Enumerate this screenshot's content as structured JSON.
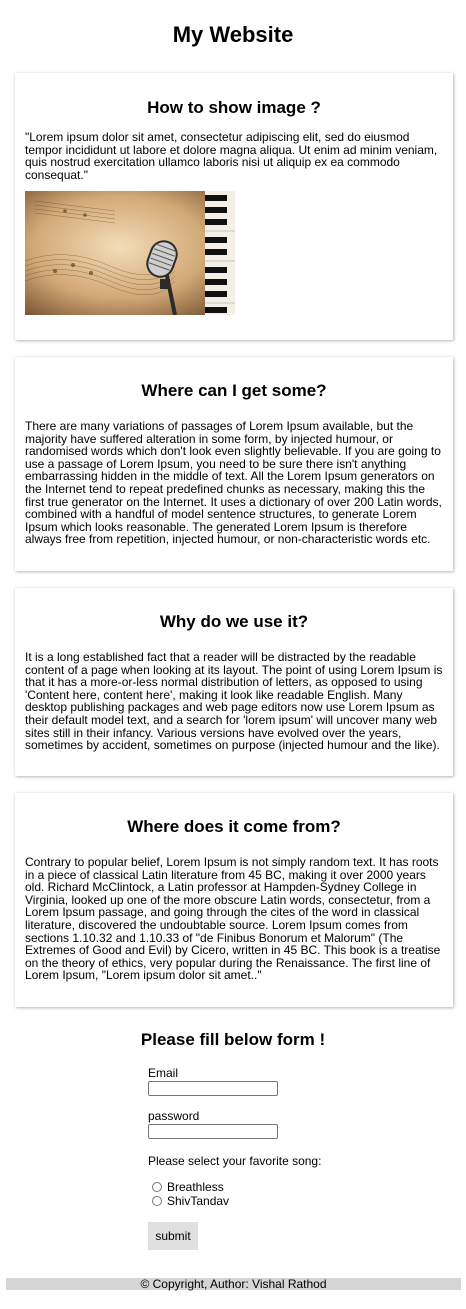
{
  "site": {
    "title": "My Website"
  },
  "cards": [
    {
      "heading": "How to show image ?",
      "text": "\"Lorem ipsum dolor sit amet, consectetur adipiscing elit, sed do eiusmod tempor incididunt ut labore et dolore magna aliqua. Ut enim ad minim veniam, quis nostrud exercitation ullamco laboris nisi ut aliquip ex ea commodo consequat.\"",
      "image_icon": "microphone-piano-image"
    },
    {
      "heading": "Where can I get some?",
      "text": "There are many variations of passages of Lorem Ipsum available, but the majority have suffered alteration in some form, by injected humour, or randomised words which don't look even slightly believable. If you are going to use a passage of Lorem Ipsum, you need to be sure there isn't anything embarrassing hidden in the middle of text. All the Lorem Ipsum generators on the Internet tend to repeat predefined chunks as necessary, making this the first true generator on the Internet. It uses a dictionary of over 200 Latin words, combined with a handful of model sentence structures, to generate Lorem Ipsum which looks reasonable. The generated Lorem Ipsum is therefore always free from repetition, injected humour, or non-characteristic words etc."
    },
    {
      "heading": "Why do we use it?",
      "text": "It is a long established fact that a reader will be distracted by the readable content of a page when looking at its layout. The point of using Lorem Ipsum is that it has a more-or-less normal distribution of letters, as opposed to using 'Content here, content here', making it look like readable English. Many desktop publishing packages and web page editors now use Lorem Ipsum as their default model text, and a search for 'lorem ipsum' will uncover many web sites still in their infancy. Various versions have evolved over the years, sometimes by accident, sometimes on purpose (injected humour and the like)."
    },
    {
      "heading": "Where does it come from?",
      "text": "Contrary to popular belief, Lorem Ipsum is not simply random text. It has roots in a piece of classical Latin literature from 45 BC, making it over 2000 years old. Richard McClintock, a Latin professor at Hampden-Sydney College in Virginia, looked up one of the more obscure Latin words, consectetur, from a Lorem Ipsum passage, and going through the cites of the word in classical literature, discovered the undoubtable source. Lorem Ipsum comes from sections 1.10.32 and 1.10.33 of \"de Finibus Bonorum et Malorum\" (The Extremes of Good and Evil) by Cicero, written in 45 BC. This book is a treatise on the theory of ethics, very popular during the Renaissance. The first line of Lorem Ipsum, \"Lorem ipsum dolor sit amet..\""
    }
  ],
  "form": {
    "title": "Please fill below form !",
    "email_label": "Email",
    "email_value": "",
    "password_label": "password",
    "password_value": "",
    "song_label": "Please select your favorite song:",
    "songs": [
      "Breathless",
      "ShivTandav"
    ],
    "submit_label": "submit"
  },
  "footer": {
    "text": "© Copyright, Author: Vishal Rathod"
  },
  "colors": {
    "footer_bg": "#d6d4d4",
    "button_bg": "#e0e0e0",
    "image_tone": "#c9a67a"
  }
}
